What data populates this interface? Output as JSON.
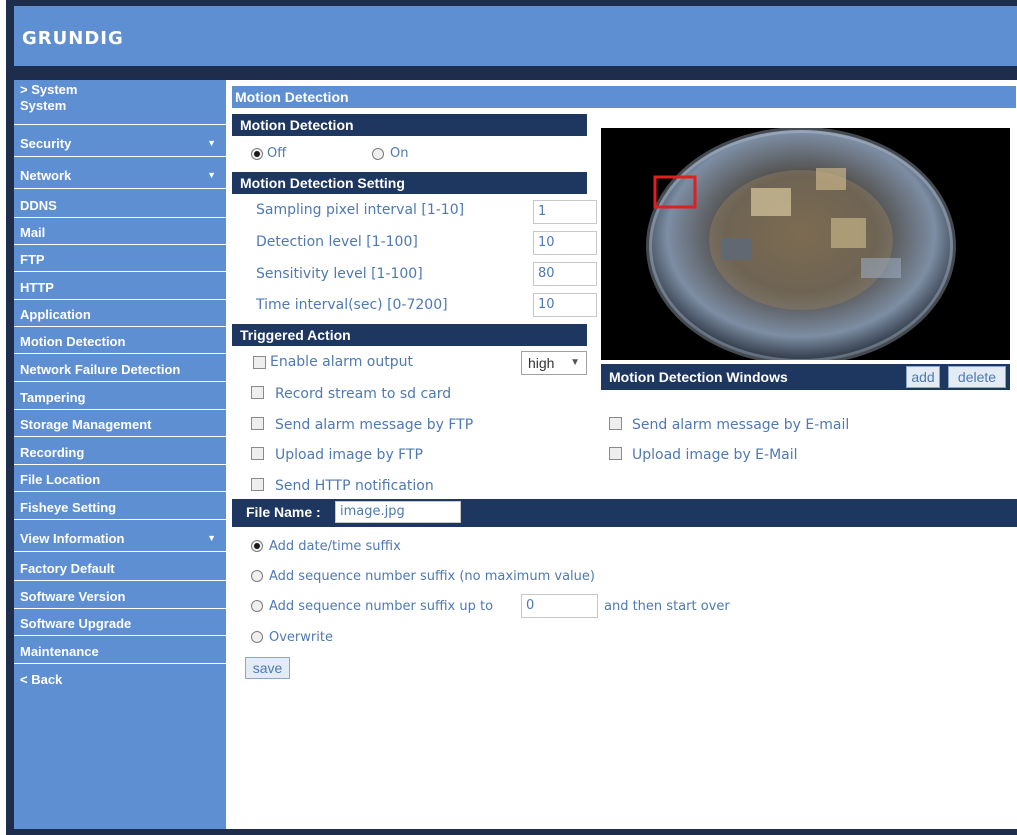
{
  "brand": "GRUNDIG",
  "sidebar": {
    "items": [
      {
        "label": "> System",
        "arrow": ""
      },
      {
        "label": "System",
        "arrow": ""
      },
      {
        "label": "Security",
        "arrow": "▼"
      },
      {
        "label": "Network",
        "arrow": "▼"
      },
      {
        "label": "DDNS",
        "arrow": ""
      },
      {
        "label": "Mail",
        "arrow": ""
      },
      {
        "label": "FTP",
        "arrow": ""
      },
      {
        "label": "HTTP",
        "arrow": ""
      },
      {
        "label": "Application",
        "arrow": ""
      },
      {
        "label": "Motion Detection",
        "arrow": ""
      },
      {
        "label": "Network Failure Detection",
        "arrow": ""
      },
      {
        "label": "Tampering",
        "arrow": ""
      },
      {
        "label": "Storage Management",
        "arrow": ""
      },
      {
        "label": "Recording",
        "arrow": ""
      },
      {
        "label": "File Location",
        "arrow": ""
      },
      {
        "label": "Fisheye Setting",
        "arrow": ""
      },
      {
        "label": "View Information",
        "arrow": "▼"
      },
      {
        "label": "Factory Default",
        "arrow": ""
      },
      {
        "label": "Software Version",
        "arrow": ""
      },
      {
        "label": "Software Upgrade",
        "arrow": ""
      },
      {
        "label": "Maintenance",
        "arrow": ""
      },
      {
        "label": "< Back",
        "arrow": ""
      }
    ]
  },
  "page_title": "Motion Detection",
  "motion": {
    "section_title": "Motion Detection",
    "off_label": "Off",
    "on_label": "On",
    "selected": "Off"
  },
  "settings": {
    "section_title": "Motion Detection Setting",
    "rows": [
      {
        "label": "Sampling pixel interval [1-10]",
        "value": "1"
      },
      {
        "label": "Detection level [1-100]",
        "value": "10"
      },
      {
        "label": "Sensitivity level [1-100]",
        "value": "80"
      },
      {
        "label": "Time interval(sec) [0-7200]",
        "value": "10"
      }
    ]
  },
  "triggered": {
    "section_title": "Triggered Action",
    "alarm_output": "Enable alarm output",
    "alarm_level": "high",
    "record_sd": "Record stream to sd card",
    "alarm_ftp": "Send alarm message by FTP",
    "alarm_email": "Send alarm message by E-mail",
    "upload_ftp": "Upload image by FTP",
    "upload_email": "Upload image by E-Mail",
    "http_notify": "Send HTTP notification"
  },
  "windows": {
    "title": "Motion Detection Windows",
    "add_label": "add",
    "delete_label": "delete"
  },
  "filename": {
    "label": "File Name :",
    "value": "image.jpg",
    "opt_datetime": "Add date/time suffix",
    "opt_seq_nomax": "Add sequence number suffix (no maximum value)",
    "opt_seq_upto": "Add sequence number suffix up to",
    "seq_max_value": "0",
    "opt_seq_upto_tail": "and then start over",
    "opt_overwrite": "Overwrite",
    "selected": "Add date/time suffix"
  },
  "save_label": "save",
  "colors": {
    "header_blue": "#5e8fd2",
    "section_navy": "#1e3760",
    "label_blue": "#4f79b3",
    "detection_window": "#e02020"
  }
}
